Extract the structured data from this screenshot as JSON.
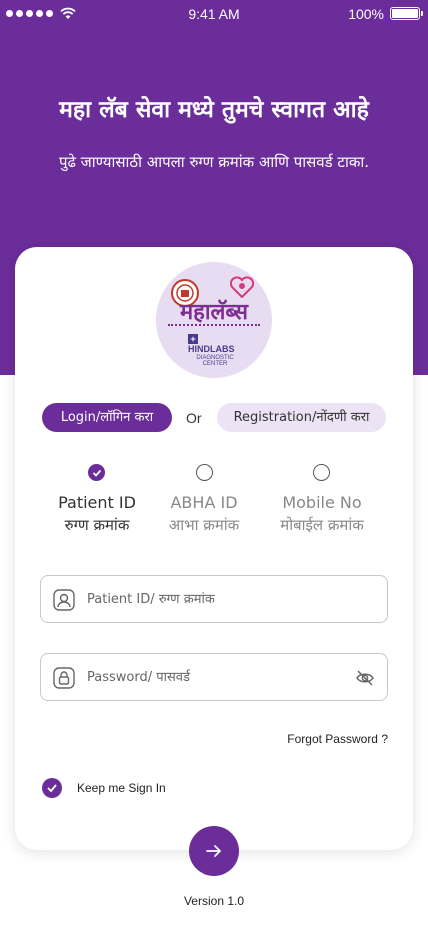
{
  "status_bar": {
    "time": "9:41 AM",
    "battery": "100%"
  },
  "header": {
    "title": "महा लॅब सेवा मध्ये तुमचे स्वागत आहे",
    "subtitle": "पुढे जाण्यासाठी आपला रुग्ण क्रमांक आणि पासवर्ड टाका."
  },
  "logo": {
    "name": "महालॅब्स",
    "partner": "HINDLABS",
    "partner_sub": "DIAGNOSTIC CENTER"
  },
  "mode_toggle": {
    "login_label": "Login/लॉगिन करा",
    "or_label": "Or",
    "register_label": "Registration/नोंदणी करा"
  },
  "id_options": [
    {
      "label": "Patient ID",
      "sub": "रुग्ण क्रमांक",
      "selected": true
    },
    {
      "label": "ABHA ID",
      "sub": "आभा क्रमांक",
      "selected": false
    },
    {
      "label": "Mobile No",
      "sub": "मोबाईल क्रमांक",
      "selected": false
    }
  ],
  "form": {
    "patient_id_placeholder": "Patient ID/ रुग्ण क्रमांक",
    "patient_id_value": "",
    "password_placeholder": "Password/ पासवर्ड",
    "password_value": "",
    "forgot_label": "Forgot Password ?",
    "keep_signed_label": "Keep me Sign In",
    "keep_signed_checked": true
  },
  "footer": {
    "version": "Version 1.0"
  },
  "colors": {
    "primary": "#6b2d9a",
    "primary_light": "#ece3f5",
    "logo_bg": "#e8dcf3"
  },
  "icons": {
    "signal": "signal-dots-icon",
    "wifi": "wifi-icon",
    "battery": "battery-icon",
    "user": "user-icon",
    "lock": "lock-icon",
    "eye_off": "eye-off-icon",
    "arrow": "arrow-right-icon",
    "check": "check-icon"
  }
}
